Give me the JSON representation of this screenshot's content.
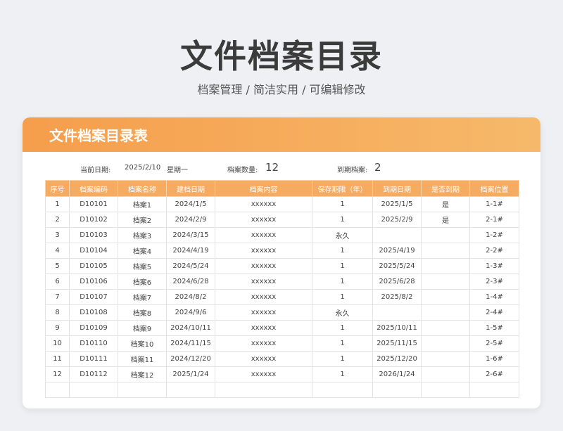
{
  "page": {
    "title": "文件档案目录",
    "subtitle": "档案管理 /  简洁实用  /  可编辑修改"
  },
  "card": {
    "title": "文件档案目录表"
  },
  "info": {
    "date_label": "当前日期:",
    "date_value": "2025/2/10",
    "weekday": "星期一",
    "count_label": "档案数量:",
    "count_value": "12",
    "expired_label": "到期档案:",
    "expired_value": "2"
  },
  "table": {
    "headers": [
      "序号",
      "档案编码",
      "档案名称",
      "建档日期",
      "档案内容",
      "保存期限（年）",
      "到期日期",
      "是否到期",
      "档案位置"
    ],
    "rows": [
      [
        "1",
        "D10101",
        "档案1",
        "2024/1/5",
        "xxxxxx",
        "1",
        "2025/1/5",
        "是",
        "1-1#"
      ],
      [
        "2",
        "D10102",
        "档案2",
        "2024/2/9",
        "xxxxxx",
        "1",
        "2025/2/9",
        "是",
        "2-1#"
      ],
      [
        "3",
        "D10103",
        "档案3",
        "2024/3/15",
        "xxxxxx",
        "永久",
        "",
        "",
        "1-2#"
      ],
      [
        "4",
        "D10104",
        "档案4",
        "2024/4/19",
        "xxxxxx",
        "1",
        "2025/4/19",
        "",
        "2-2#"
      ],
      [
        "5",
        "D10105",
        "档案5",
        "2024/5/24",
        "xxxxxx",
        "1",
        "2025/5/24",
        "",
        "1-3#"
      ],
      [
        "6",
        "D10106",
        "档案6",
        "2024/6/28",
        "xxxxxx",
        "1",
        "2025/6/28",
        "",
        "2-3#"
      ],
      [
        "7",
        "D10107",
        "档案7",
        "2024/8/2",
        "xxxxxx",
        "1",
        "2025/8/2",
        "",
        "1-4#"
      ],
      [
        "8",
        "D10108",
        "档案8",
        "2024/9/6",
        "xxxxxx",
        "永久",
        "",
        "",
        "2-4#"
      ],
      [
        "9",
        "D10109",
        "档案9",
        "2024/10/11",
        "xxxxxx",
        "1",
        "2025/10/11",
        "",
        "1-5#"
      ],
      [
        "10",
        "D10110",
        "档案10",
        "2024/11/15",
        "xxxxxx",
        "1",
        "2025/11/15",
        "",
        "2-5#"
      ],
      [
        "11",
        "D10111",
        "档案11",
        "2024/12/20",
        "xxxxxx",
        "1",
        "2025/12/20",
        "",
        "1-6#"
      ],
      [
        "12",
        "D10112",
        "档案12",
        "2025/1/24",
        "xxxxxx",
        "1",
        "2026/1/24",
        "",
        "2-6#"
      ],
      [
        "",
        "",
        "",
        "",
        "",
        "",
        "",
        "",
        ""
      ]
    ]
  }
}
